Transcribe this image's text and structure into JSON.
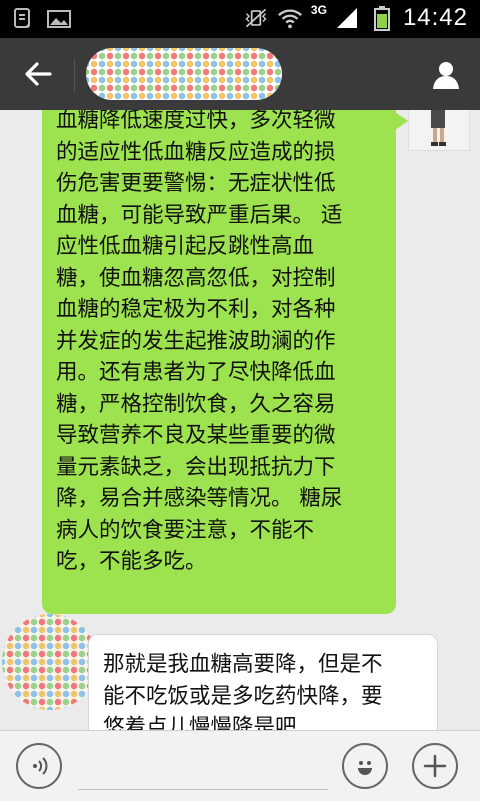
{
  "status_bar": {
    "network": "3G",
    "time": "14:42",
    "icons": [
      "screenshot-icon",
      "gallery-icon",
      "vibrate-mute-icon",
      "wifi-icon",
      "signal-icon",
      "battery-icon"
    ]
  },
  "header": {
    "back_icon": "arrow-left-icon",
    "profile_icon": "person-icon",
    "title": ""
  },
  "messages": [
    {
      "side": "right",
      "bubble_color": "#9de24f",
      "text": "血糖降低速度过快，多次轻微\n的适应性低血糖反应造成的损\n伤危害更要警惕：无症状性低\n血糖，可能导致严重后果。 适\n应性低血糖引起反跳性高血\n糖，使血糖忽高忽低，对控制\n血糖的稳定极为不利，对各种\n并发症的发生起推波助澜的作\n用。还有患者为了尽快降低血\n糖，严格控制饮食，久之容易\n导致营养不良及某些重要的微\n量元素缺乏，会出现抵抗力下\n降，易合并感染等情况。 糖尿\n病人的饮食要注意，不能不\n吃，不能多吃。"
    },
    {
      "side": "left",
      "bubble_color": "#ffffff",
      "text": "那就是我血糖高要降，但是不\n能不吃饭或是多吃药快降，要\n悠着点儿慢慢降是吧"
    }
  ],
  "bottom_bar": {
    "voice_icon": "voice-icon",
    "emoji_icon": "emoji-icon",
    "plus_icon": "plus-icon"
  },
  "colors": {
    "status_bar_bg": "#000000",
    "title_bar_bg": "#3a3a3a",
    "chat_bg": "#ebebeb",
    "sent_bubble": "#9de24f",
    "received_bubble": "#ffffff"
  }
}
